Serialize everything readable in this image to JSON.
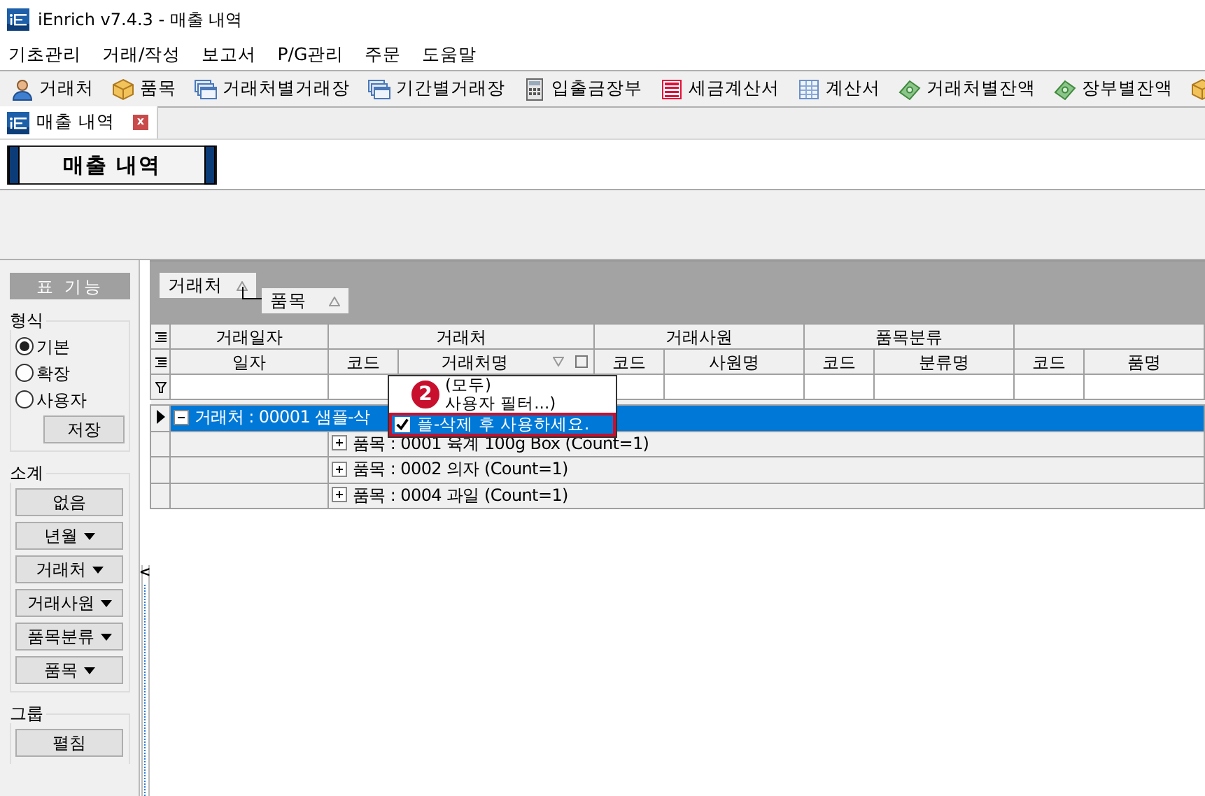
{
  "window": {
    "title": "iEnrich v7.4.3 - 매출 내역"
  },
  "menu": [
    "기초관리",
    "거래/작성",
    "보고서",
    "P/G관리",
    "주문",
    "도움말"
  ],
  "toolbar": [
    {
      "kind": "person",
      "label": "거래처"
    },
    {
      "kind": "box",
      "label": "품목"
    },
    {
      "kind": "windows",
      "label": "거래처별거래장"
    },
    {
      "kind": "windows",
      "label": "기간별거래장"
    },
    {
      "kind": "calculator",
      "label": "입출금장부"
    },
    {
      "kind": "redsheet",
      "label": "세금계산서"
    },
    {
      "kind": "sheet",
      "label": "계산서"
    },
    {
      "kind": "money",
      "label": "거래처별잔액"
    },
    {
      "kind": "money",
      "label": "장부별잔액"
    },
    {
      "kind": "box"
    }
  ],
  "document_tabs": [
    {
      "label": "매출 내역",
      "selected": true,
      "close": "x"
    }
  ],
  "panel_title": "매출 내역",
  "side_panel": {
    "header": "표 기능",
    "format": {
      "label": "형식",
      "options": [
        {
          "label": "기본",
          "selected": true
        },
        {
          "label": "확장",
          "selected": false
        },
        {
          "label": "사용자",
          "selected": false
        }
      ],
      "save": "저장"
    },
    "subtotal": {
      "label": "소계",
      "buttons": [
        {
          "label": "없음",
          "dropdown": false
        },
        {
          "label": "년월",
          "dropdown": true
        },
        {
          "label": "거래처",
          "dropdown": true
        },
        {
          "label": "거래사원",
          "dropdown": true
        },
        {
          "label": "품목분류",
          "dropdown": true
        },
        {
          "label": "품목",
          "dropdown": true
        }
      ]
    },
    "group": {
      "label": "그룹",
      "buttons": [
        "펼침"
      ]
    },
    "collapse_arrow": "<"
  },
  "grid": {
    "group_by": [
      "거래처",
      "품목"
    ],
    "column_groups": [
      "거래일자",
      "거래처",
      "거래사원",
      "품목분류"
    ],
    "columns": [
      {
        "label": "일자",
        "filter": false
      },
      {
        "label": "코드",
        "filter": false
      },
      {
        "label": "거래처명",
        "filter": true
      },
      {
        "label": "코드",
        "filter": false
      },
      {
        "label": "사원명",
        "filter": false
      },
      {
        "label": "코드",
        "filter": false
      },
      {
        "label": "분류명",
        "filter": false
      },
      {
        "label": "코드",
        "filter": false
      },
      {
        "label": "품명",
        "filter": false
      }
    ],
    "rows": [
      {
        "kind": "group",
        "text": "거래처 : 00001 샘플-삭",
        "expanded": true,
        "selected": true
      },
      {
        "kind": "subgroup",
        "text": "품목 : 0001 육계 100g Box (Count=1)",
        "expanded": false,
        "selected": false
      },
      {
        "kind": "subgroup",
        "text": "품목 : 0002 의자  (Count=1)",
        "expanded": false,
        "selected": false
      },
      {
        "kind": "subgroup",
        "text": "품목 : 0004 과일  (Count=1)",
        "expanded": false,
        "selected": false
      }
    ]
  },
  "filter_popup": {
    "items": [
      {
        "label": "(모두)",
        "checked": false,
        "selected": false
      },
      {
        "label": "사용자 필터...)",
        "checked": false,
        "selected": false
      },
      {
        "label": "플-삭제 후 사용하세요.",
        "checked": true,
        "selected": true
      }
    ],
    "callout": "2"
  }
}
